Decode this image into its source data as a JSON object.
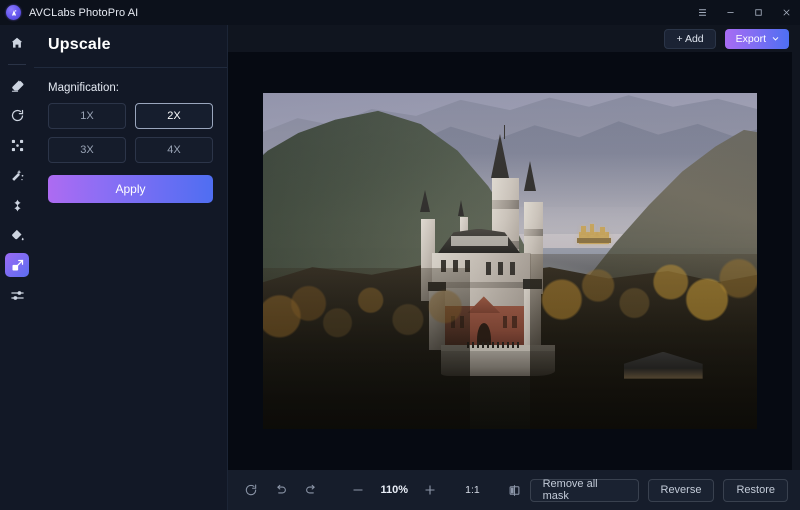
{
  "window": {
    "app_name": "AVCLabs PhotoPro AI",
    "logo_icon": "avclabs-logo-icon",
    "controls": [
      {
        "name": "menu-button",
        "icon": "hamburger-menu-icon"
      },
      {
        "name": "minimize-button",
        "icon": "minimize-icon"
      },
      {
        "name": "maximize-button",
        "icon": "maximize-icon"
      },
      {
        "name": "close-button",
        "icon": "close-icon"
      }
    ]
  },
  "rail": {
    "items": [
      {
        "name": "home",
        "icon": "home-icon",
        "active": false
      },
      {
        "name": "erase",
        "icon": "eraser-icon",
        "active": false
      },
      {
        "name": "refresh",
        "icon": "refresh-icon",
        "active": false
      },
      {
        "name": "enhance",
        "icon": "enhance-corners-icon",
        "active": false
      },
      {
        "name": "magic-wand",
        "icon": "magic-wand-icon",
        "active": false
      },
      {
        "name": "retouch",
        "icon": "retouch-sparkle-icon",
        "active": false
      },
      {
        "name": "colorize",
        "icon": "paint-drop-icon",
        "active": false
      },
      {
        "name": "upscale",
        "icon": "upscale-expand-icon",
        "active": true
      },
      {
        "name": "adjust",
        "icon": "sliders-icon",
        "active": false
      }
    ]
  },
  "panel": {
    "title": "Upscale",
    "magnification_label": "Magnification:",
    "magnification_options": [
      {
        "label": "1X",
        "selected": false
      },
      {
        "label": "2X",
        "selected": true
      },
      {
        "label": "3X",
        "selected": false
      },
      {
        "label": "4X",
        "selected": false
      }
    ],
    "apply_label": "Apply"
  },
  "toolbar_top": {
    "add_label": "+ Add",
    "export_label": "Export",
    "export_chevron_icon": "chevron-down-icon"
  },
  "bottombar": {
    "reset_icon": "reset-rotate-icon",
    "undo_icon": "undo-icon",
    "redo_icon": "redo-icon",
    "zoom_out_icon": "minus-icon",
    "zoom_level": "110%",
    "zoom_in_icon": "plus-icon",
    "actual_size_label": "1:1",
    "compare_icon": "split-compare-icon",
    "buttons": [
      {
        "label": "Remove all mask",
        "name": "remove-all-mask-button"
      },
      {
        "label": "Reverse",
        "name": "reverse-button"
      },
      {
        "label": "Restore",
        "name": "restore-button"
      }
    ]
  },
  "canvas": {
    "image_alt": "Neuschwanstein Castle on a forested hill with autumn trees and misty alpine mountains"
  },
  "colors": {
    "accent_purple": "#a86cf3",
    "accent_blue": "#4e6ff2",
    "panel_bg": "#121826",
    "canvas_bg": "#060a12",
    "titlebar_bg": "#0c111b",
    "bottombar_bg": "#161d2b"
  }
}
